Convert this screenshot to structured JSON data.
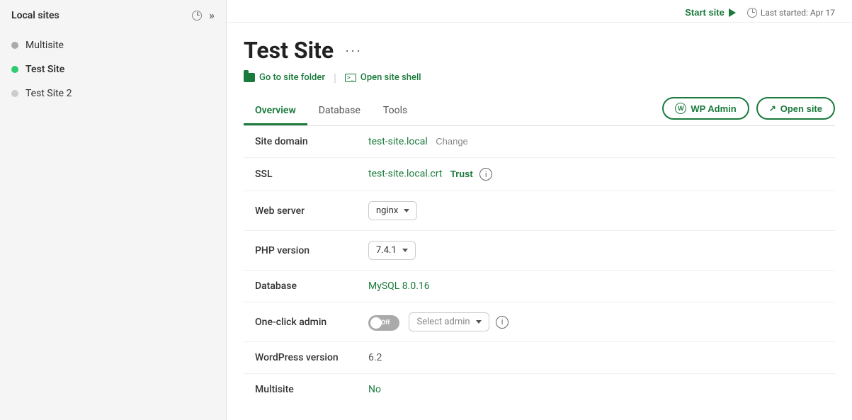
{
  "sidebar": {
    "title": "Local sites",
    "items": [
      {
        "id": "multisite",
        "label": "Multisite",
        "dotColor": "dot-gray",
        "active": false
      },
      {
        "id": "test-site",
        "label": "Test Site",
        "dotColor": "dot-green",
        "active": true
      },
      {
        "id": "test-site-2",
        "label": "Test Site 2",
        "dotColor": "dot-off",
        "active": false
      }
    ]
  },
  "topbar": {
    "start_site_label": "Start site",
    "last_started_label": "Last started: Apr 17"
  },
  "site": {
    "title": "Test Site",
    "more_btn_label": "···",
    "quick_links": [
      {
        "id": "site-folder",
        "label": "Go to site folder",
        "icon": "folder"
      },
      {
        "id": "site-shell",
        "label": "Open site shell",
        "icon": "terminal"
      }
    ],
    "tabs": [
      {
        "id": "overview",
        "label": "Overview",
        "active": true
      },
      {
        "id": "database",
        "label": "Database",
        "active": false
      },
      {
        "id": "tools",
        "label": "Tools",
        "active": false
      }
    ],
    "action_buttons": [
      {
        "id": "wp-admin",
        "label": "WP Admin",
        "icon": "wp"
      },
      {
        "id": "open-site",
        "label": "Open site",
        "icon": "external"
      }
    ],
    "overview": {
      "fields": [
        {
          "id": "site-domain",
          "label": "Site domain",
          "value": "test-site.local",
          "extra": "Change"
        },
        {
          "id": "ssl",
          "label": "SSL",
          "value": "test-site.local.crt",
          "extra_btn": "Trust",
          "info": true
        },
        {
          "id": "web-server",
          "label": "Web server",
          "dropdown": "nginx"
        },
        {
          "id": "php-version",
          "label": "PHP version",
          "dropdown": "7.4.1"
        },
        {
          "id": "database",
          "label": "Database",
          "value": "MySQL 8.0.16"
        },
        {
          "id": "one-click-admin",
          "label": "One-click admin",
          "toggle": "Off",
          "select_admin": "Select admin",
          "info": true
        },
        {
          "id": "wordpress-version",
          "label": "WordPress version",
          "value": "6.2"
        },
        {
          "id": "multisite",
          "label": "Multisite",
          "value": "No",
          "value_color": "green"
        }
      ]
    }
  }
}
